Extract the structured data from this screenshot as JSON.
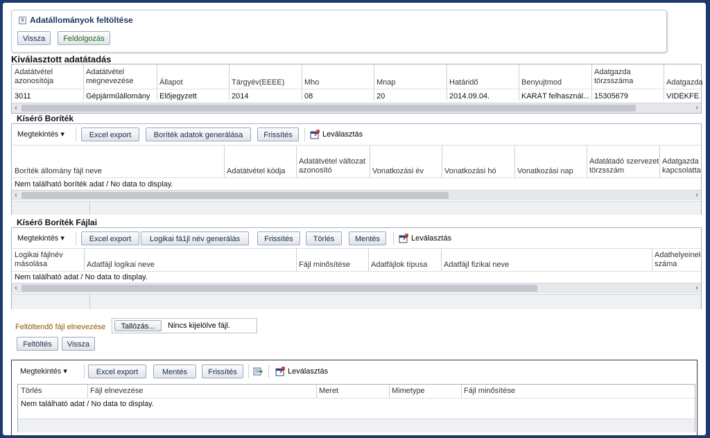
{
  "upload_panel": {
    "title": "Adatállományok feltöltése",
    "back_label": "Vissza",
    "process_label": "Feldolgozás"
  },
  "selected": {
    "title": "Kiválasztott adatátadás",
    "headers": [
      "Adatátvétel azonosítója",
      "Adatátvétel megnevezése",
      "Állapot",
      "Tárgyév(EEEE)",
      "Mho",
      "Mnap",
      "Határidő",
      "Benyujtmod",
      "Adatgazda törzsszáma",
      "Adatgazda"
    ],
    "row": [
      "3011",
      "Gépjárműállomány",
      "Előjegyzett",
      "2014",
      "08",
      "20",
      "2014.09.04.",
      "KARÁT felhasznál...",
      "15305679",
      "VIDÉKFEJL"
    ]
  },
  "envelope": {
    "title": "Kísérő Boríték",
    "toolbar": {
      "view": "Megtekintés",
      "excel": "Excel export",
      "generate": "Boríték adatok generálása",
      "refresh": "Frissítés",
      "detach": "Leválasztás"
    },
    "headers": [
      "Boríték állomány fájl neve",
      "Adatátvétel kódja",
      "Adatátvétel változat azonosító",
      "Vonatkozási év",
      "Vonatkozási hó",
      "Vonatkozási nap",
      "Adatátadó szervezet törzsszám",
      "Adatgazda kapcsolattartó"
    ],
    "no_data": "Nem található boríték adat / No data to display."
  },
  "envelope_files": {
    "title": "Kísérő Boríték Fájlai",
    "toolbar": {
      "view": "Megtekintés",
      "excel": "Excel export",
      "generate": "Logikai fá1jl név generálás",
      "refresh": "Frissítés",
      "delete": "Törlés",
      "save": "Mentés",
      "detach": "Leválasztás"
    },
    "headers": [
      "Logikai fájlnév másolása",
      "Adatfájl logikai neve",
      "Fájl minősítése",
      "Adatfájlok típusa",
      "Adatfájl fizikai neve",
      "Adathelyeinek száma"
    ],
    "no_data": "Nem található adat / No data to display."
  },
  "file_upload": {
    "label": "Feltöltendő fájl elnevezése",
    "browse": "Tallózás...",
    "no_file": "Nincs kijelölve fájl.",
    "upload": "Feltöltés",
    "back": "Vissza"
  },
  "files": {
    "toolbar": {
      "view": "Megtekintés",
      "excel": "Excel export",
      "save": "Mentés",
      "refresh": "Frissítés",
      "detach": "Leválasztás"
    },
    "headers": [
      "Törlés",
      "Fájl elnevezése",
      "Meret",
      "Mimetype",
      "Fájl minősítése"
    ],
    "no_data": "Nem található adat / No data to display."
  },
  "icons": {
    "dropdown": "chevron-down-icon",
    "detach": "detach-window-icon",
    "add_row": "add-row-icon",
    "disclosure": "collapse-icon"
  },
  "colors": {
    "frame": "#1c3a6e",
    "title": "#17365d",
    "border": "#a5b1c2",
    "label_orange": "#8a5a00"
  }
}
